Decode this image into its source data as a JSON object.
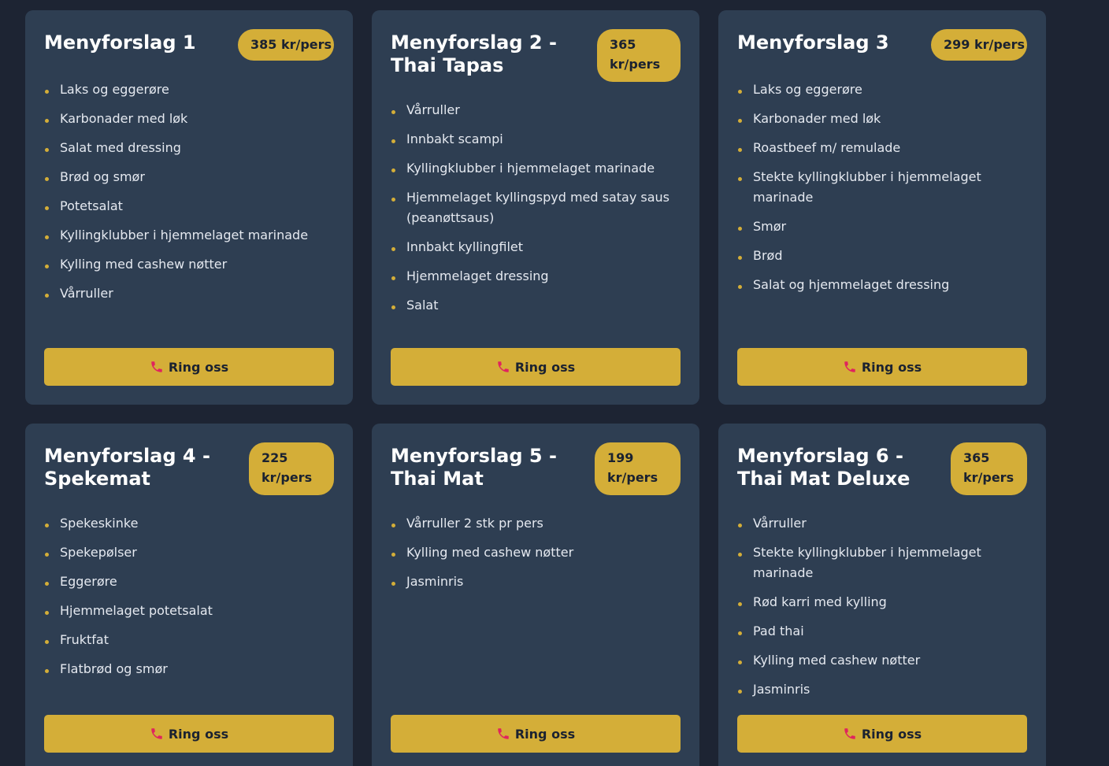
{
  "cards": [
    {
      "title": "Menyforslag 1",
      "price": "385 kr/pers",
      "items": [
        "Laks og eggerøre",
        "Karbonader med løk",
        "Salat med dressing",
        "Brød og smør",
        "Potetsalat",
        "Kyllingklubber i hjemmelaget marinade",
        "Kylling med cashew nøtter",
        "Vårruller"
      ],
      "button": "Ring oss"
    },
    {
      "title": "Menyforslag 2 - Thai Tapas",
      "price": "365 kr/pers",
      "items": [
        "Vårruller",
        "Innbakt scampi",
        "Kyllingklubber i hjemmelaget marinade",
        "Hjemmelaget kyllingspyd med satay saus (peanøttsaus)",
        "Innbakt kyllingfilet",
        "Hjemmelaget dressing",
        "Salat"
      ],
      "button": "Ring oss"
    },
    {
      "title": "Menyforslag 3",
      "price": "299 kr/pers",
      "items": [
        "Laks og eggerøre",
        "Karbonader med løk",
        "Roastbeef m/ remulade",
        "Stekte kyllingklubber i hjemmelaget marinade",
        "Smør",
        "Brød",
        "Salat og hjemmelaget dressing"
      ],
      "button": "Ring oss"
    },
    {
      "title": "Menyforslag 4 - Spekemat",
      "price": "225 kr/pers",
      "items": [
        "Spekeskinke",
        "Spekepølser",
        "Eggerøre",
        "Hjemmelaget potetsalat",
        "Fruktfat",
        "Flatbrød og smør"
      ],
      "button": "Ring oss"
    },
    {
      "title": "Menyforslag 5 - Thai Mat",
      "price": "199 kr/pers",
      "items": [
        "Vårruller 2 stk pr pers",
        "Kylling med cashew nøtter",
        "Jasminris"
      ],
      "button": "Ring oss"
    },
    {
      "title": "Menyforslag 6 - Thai Mat Deluxe",
      "price": "365 kr/pers",
      "items": [
        "Vårruller",
        "Stekte kyllingklubber i hjemmelaget marinade",
        "Rød karri med kylling",
        "Pad thai",
        "Kylling med cashew nøtter",
        "Jasminris"
      ],
      "button": "Ring oss"
    }
  ],
  "colors": {
    "page_background": "#1d2433",
    "card_background": "#2e3e52",
    "accent": "#d4ae38",
    "phone_icon": "#e0245e"
  },
  "icons": {
    "bullet": "bullet-dot-icon",
    "button": "phone-icon"
  }
}
